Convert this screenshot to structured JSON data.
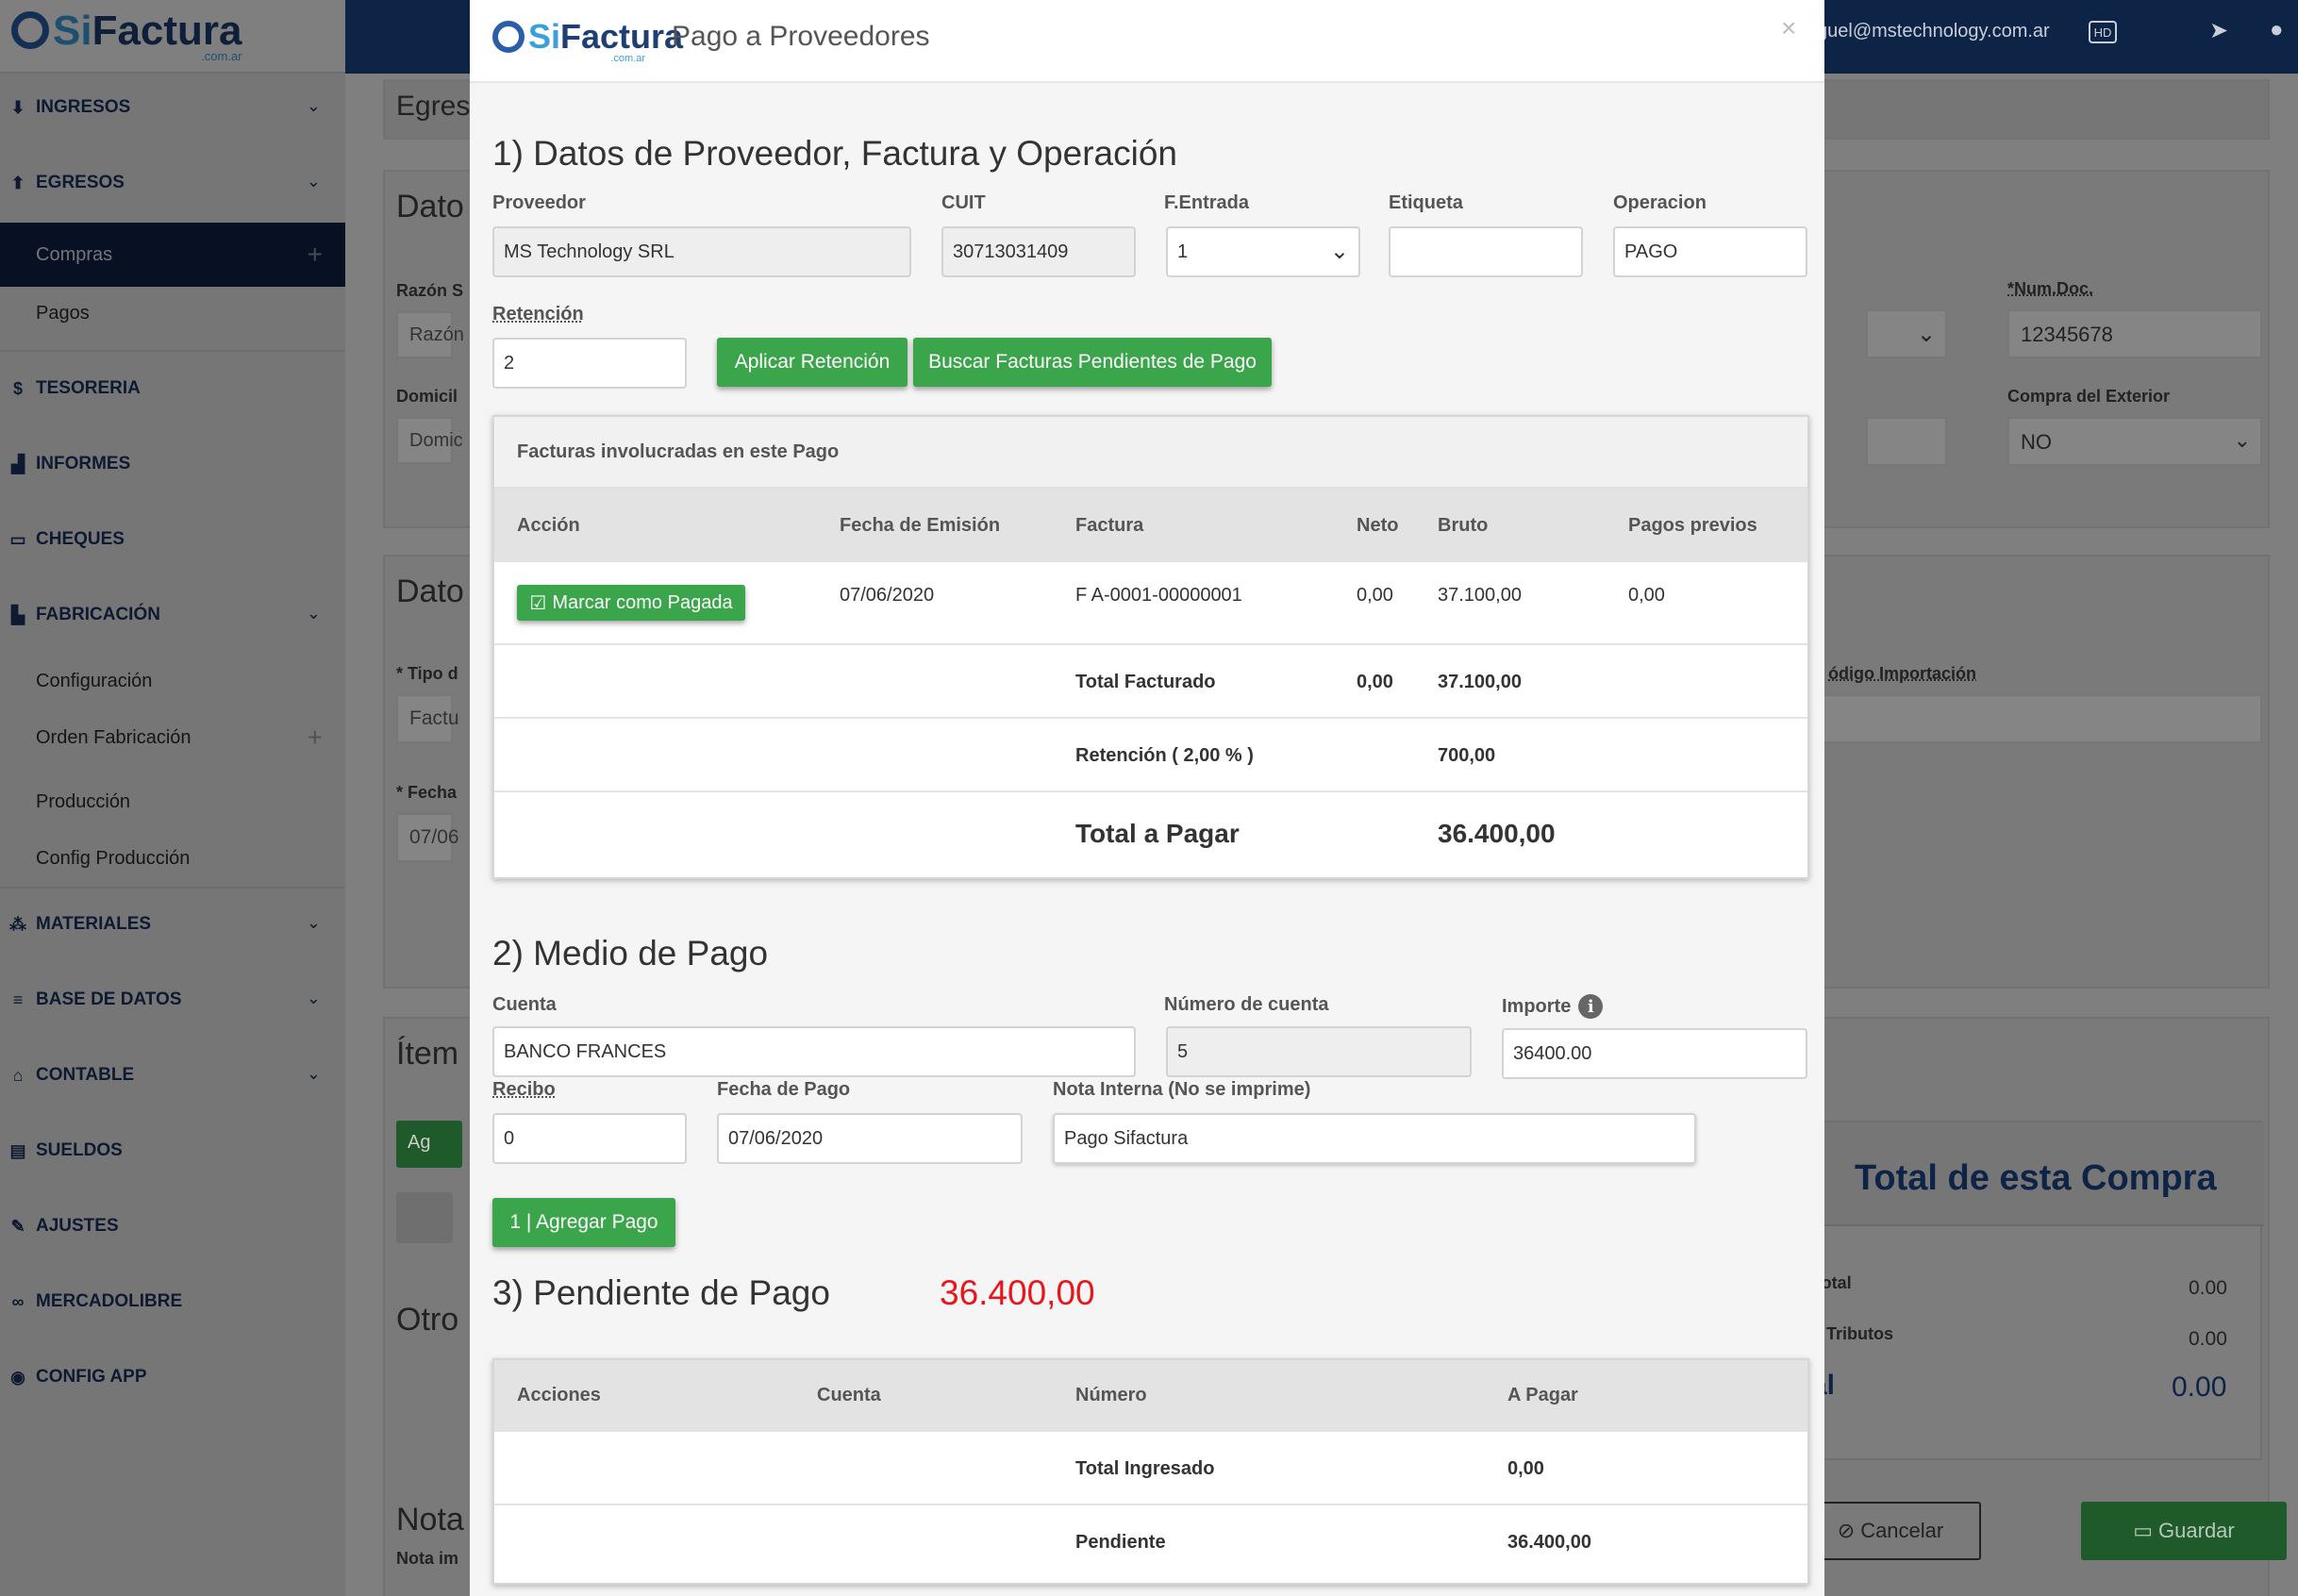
{
  "brand": {
    "name_a": "Si",
    "name_b": "Factura",
    "suffix": ".com.ar"
  },
  "sidebar": {
    "items": [
      {
        "label": "INGRESOS",
        "icon": "download-icon"
      },
      {
        "label": "EGRESOS",
        "icon": "upload-icon"
      },
      {
        "label": "TESORERIA",
        "icon": "dollar-icon"
      },
      {
        "label": "INFORMES",
        "icon": "area-chart-icon"
      },
      {
        "label": "CHEQUES",
        "icon": "card-icon"
      },
      {
        "label": "FABRICACIÓN",
        "icon": "industry-icon"
      },
      {
        "label": "MATERIALES",
        "icon": "cubes-icon"
      },
      {
        "label": "BASE DE DATOS",
        "icon": "database-icon"
      },
      {
        "label": "CONTABLE",
        "icon": "bank-icon"
      },
      {
        "label": "SUELDOS",
        "icon": "money-icon"
      },
      {
        "label": "AJUSTES",
        "icon": "wrench-icon"
      },
      {
        "label": "MERCADOLIBRE",
        "icon": "handshake-icon"
      },
      {
        "label": "CONFIG APP",
        "icon": "gamepad-icon"
      }
    ],
    "egresos_sub": [
      "Compras",
      "Pagos"
    ],
    "fabricacion_sub": [
      "Configuración",
      "Orden Fabricación",
      "Producción",
      "Config Producción"
    ]
  },
  "topbar": {
    "email": "guel@mstechnology.com.ar",
    "hd": "HD"
  },
  "background": {
    "crumb": "Egres",
    "card1_title": "Dato",
    "card2_title": "Dato",
    "card3_title": "Ítem",
    "otros": "Otro",
    "nota": "Nota",
    "nota_sub": "Nota im",
    "razon_lbl": "Razón S",
    "razon_ph": "Razón",
    "domic_lbl": "Domicil",
    "domic_ph": "Domic",
    "tipo_lbl": "* Tipo d",
    "tipo_val": "Factu",
    "fecha_lbl": "* Fecha",
    "fecha_val": "07/06",
    "add_btn": "Ag",
    "numdoc_lbl": "*Num.Doc.",
    "numdoc_val": "12345678",
    "exterior_lbl": "Compra del Exterior",
    "exterior_val": "NO",
    "codimp_lbl": "ódigo Importación",
    "total_title": "Total de esta Compra",
    "subtotal_lbl": "oTotal",
    "subtotal_val": "0.00",
    "tributos_lbl": "os Tributos",
    "tributos_val": "0.00",
    "total_lbl": "tal",
    "total_val": "0.00",
    "cancel_btn": "Cancelar",
    "save_btn": "Guardar"
  },
  "modal": {
    "title": "Pago a Proveedores",
    "section1": "1) Datos de Proveedor, Factura y Operación",
    "proveedor_lbl": "Proveedor",
    "proveedor_val": "MS Technology SRL",
    "cuit_lbl": "CUIT",
    "cuit_val": "30713031409",
    "fentrada_lbl": "F.Entrada",
    "fentrada_val": "1",
    "etiqueta_lbl": "Etiqueta",
    "etiqueta_val": "",
    "operacion_lbl": "Operacion",
    "operacion_val": "PAGO",
    "retencion_lbl": "Retención",
    "retencion_val": "2",
    "aplicar_btn": "Aplicar Retención",
    "buscar_btn": "Buscar Facturas Pendientes de Pago",
    "facturas_panel": {
      "heading": "Facturas involucradas en este Pago",
      "headers": [
        "Acción",
        "Fecha de Emisión",
        "Factura",
        "Neto",
        "Bruto",
        "Pagos previos"
      ],
      "row": {
        "action": "Marcar como Pagada",
        "fecha": "07/06/2020",
        "factura": "F A-0001-00000001",
        "neto": "0,00",
        "bruto": "37.100,00",
        "previos": "0,00"
      },
      "total_facturado_lbl": "Total Facturado",
      "total_facturado_neto": "0,00",
      "total_facturado_bruto": "37.100,00",
      "retencion_lbl": "Retención ( 2,00 % )",
      "retencion_val": "700,00",
      "total_pagar_lbl": "Total a Pagar",
      "total_pagar_val": "36.400,00"
    },
    "section2": "2) Medio de Pago",
    "cuenta_lbl": "Cuenta",
    "cuenta_val": "BANCO FRANCES",
    "numcuenta_lbl": "Número de cuenta",
    "numcuenta_val": "5",
    "importe_lbl": "Importe",
    "importe_val": "36400.00",
    "recibo_lbl": "Recibo",
    "recibo_val": "0",
    "fechapago_lbl": "Fecha de Pago",
    "fechapago_val": "07/06/2020",
    "nota_lbl": "Nota Interna (No se imprime)",
    "nota_val": "Pago Sifactura",
    "agregar_btn": "1 | Agregar Pago",
    "section3": "3) Pendiente de Pago",
    "pendiente_amount": "36.400,00",
    "pend_panel": {
      "headers": [
        "Acciones",
        "Cuenta",
        "Número",
        "A Pagar"
      ],
      "total_ingresado_lbl": "Total Ingresado",
      "total_ingresado_val": "0,00",
      "pendiente_lbl": "Pendiente",
      "pendiente_val": "36.400,00"
    }
  },
  "colors": {
    "navy": "#0d2447",
    "green": "#3aa54a",
    "red": "#e8151b"
  }
}
